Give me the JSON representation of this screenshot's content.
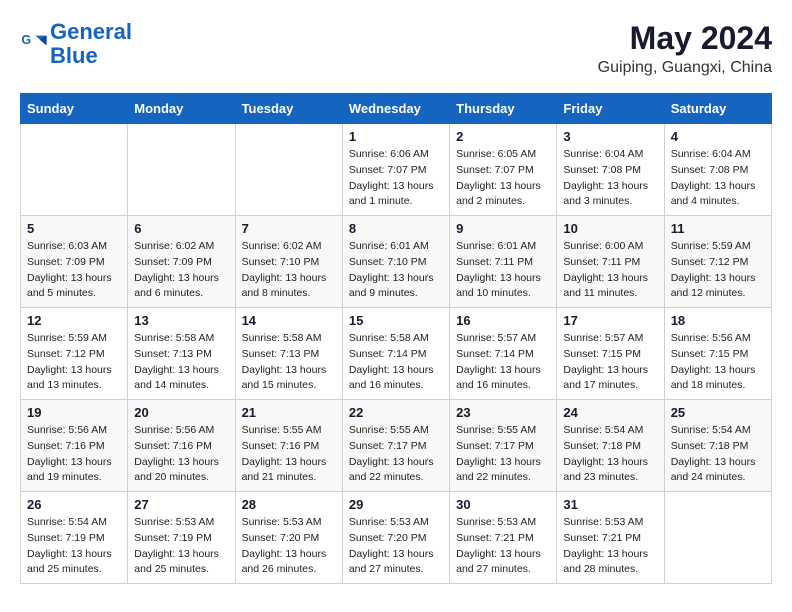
{
  "header": {
    "logo_general": "General",
    "logo_blue": "Blue",
    "month": "May 2024",
    "location": "Guiping, Guangxi, China"
  },
  "weekdays": [
    "Sunday",
    "Monday",
    "Tuesday",
    "Wednesday",
    "Thursday",
    "Friday",
    "Saturday"
  ],
  "weeks": [
    [
      {
        "day": "",
        "info": ""
      },
      {
        "day": "",
        "info": ""
      },
      {
        "day": "",
        "info": ""
      },
      {
        "day": "1",
        "info": "Sunrise: 6:06 AM\nSunset: 7:07 PM\nDaylight: 13 hours\nand 1 minute."
      },
      {
        "day": "2",
        "info": "Sunrise: 6:05 AM\nSunset: 7:07 PM\nDaylight: 13 hours\nand 2 minutes."
      },
      {
        "day": "3",
        "info": "Sunrise: 6:04 AM\nSunset: 7:08 PM\nDaylight: 13 hours\nand 3 minutes."
      },
      {
        "day": "4",
        "info": "Sunrise: 6:04 AM\nSunset: 7:08 PM\nDaylight: 13 hours\nand 4 minutes."
      }
    ],
    [
      {
        "day": "5",
        "info": "Sunrise: 6:03 AM\nSunset: 7:09 PM\nDaylight: 13 hours\nand 5 minutes."
      },
      {
        "day": "6",
        "info": "Sunrise: 6:02 AM\nSunset: 7:09 PM\nDaylight: 13 hours\nand 6 minutes."
      },
      {
        "day": "7",
        "info": "Sunrise: 6:02 AM\nSunset: 7:10 PM\nDaylight: 13 hours\nand 8 minutes."
      },
      {
        "day": "8",
        "info": "Sunrise: 6:01 AM\nSunset: 7:10 PM\nDaylight: 13 hours\nand 9 minutes."
      },
      {
        "day": "9",
        "info": "Sunrise: 6:01 AM\nSunset: 7:11 PM\nDaylight: 13 hours\nand 10 minutes."
      },
      {
        "day": "10",
        "info": "Sunrise: 6:00 AM\nSunset: 7:11 PM\nDaylight: 13 hours\nand 11 minutes."
      },
      {
        "day": "11",
        "info": "Sunrise: 5:59 AM\nSunset: 7:12 PM\nDaylight: 13 hours\nand 12 minutes."
      }
    ],
    [
      {
        "day": "12",
        "info": "Sunrise: 5:59 AM\nSunset: 7:12 PM\nDaylight: 13 hours\nand 13 minutes."
      },
      {
        "day": "13",
        "info": "Sunrise: 5:58 AM\nSunset: 7:13 PM\nDaylight: 13 hours\nand 14 minutes."
      },
      {
        "day": "14",
        "info": "Sunrise: 5:58 AM\nSunset: 7:13 PM\nDaylight: 13 hours\nand 15 minutes."
      },
      {
        "day": "15",
        "info": "Sunrise: 5:58 AM\nSunset: 7:14 PM\nDaylight: 13 hours\nand 16 minutes."
      },
      {
        "day": "16",
        "info": "Sunrise: 5:57 AM\nSunset: 7:14 PM\nDaylight: 13 hours\nand 16 minutes."
      },
      {
        "day": "17",
        "info": "Sunrise: 5:57 AM\nSunset: 7:15 PM\nDaylight: 13 hours\nand 17 minutes."
      },
      {
        "day": "18",
        "info": "Sunrise: 5:56 AM\nSunset: 7:15 PM\nDaylight: 13 hours\nand 18 minutes."
      }
    ],
    [
      {
        "day": "19",
        "info": "Sunrise: 5:56 AM\nSunset: 7:16 PM\nDaylight: 13 hours\nand 19 minutes."
      },
      {
        "day": "20",
        "info": "Sunrise: 5:56 AM\nSunset: 7:16 PM\nDaylight: 13 hours\nand 20 minutes."
      },
      {
        "day": "21",
        "info": "Sunrise: 5:55 AM\nSunset: 7:16 PM\nDaylight: 13 hours\nand 21 minutes."
      },
      {
        "day": "22",
        "info": "Sunrise: 5:55 AM\nSunset: 7:17 PM\nDaylight: 13 hours\nand 22 minutes."
      },
      {
        "day": "23",
        "info": "Sunrise: 5:55 AM\nSunset: 7:17 PM\nDaylight: 13 hours\nand 22 minutes."
      },
      {
        "day": "24",
        "info": "Sunrise: 5:54 AM\nSunset: 7:18 PM\nDaylight: 13 hours\nand 23 minutes."
      },
      {
        "day": "25",
        "info": "Sunrise: 5:54 AM\nSunset: 7:18 PM\nDaylight: 13 hours\nand 24 minutes."
      }
    ],
    [
      {
        "day": "26",
        "info": "Sunrise: 5:54 AM\nSunset: 7:19 PM\nDaylight: 13 hours\nand 25 minutes."
      },
      {
        "day": "27",
        "info": "Sunrise: 5:53 AM\nSunset: 7:19 PM\nDaylight: 13 hours\nand 25 minutes."
      },
      {
        "day": "28",
        "info": "Sunrise: 5:53 AM\nSunset: 7:20 PM\nDaylight: 13 hours\nand 26 minutes."
      },
      {
        "day": "29",
        "info": "Sunrise: 5:53 AM\nSunset: 7:20 PM\nDaylight: 13 hours\nand 27 minutes."
      },
      {
        "day": "30",
        "info": "Sunrise: 5:53 AM\nSunset: 7:21 PM\nDaylight: 13 hours\nand 27 minutes."
      },
      {
        "day": "31",
        "info": "Sunrise: 5:53 AM\nSunset: 7:21 PM\nDaylight: 13 hours\nand 28 minutes."
      },
      {
        "day": "",
        "info": ""
      }
    ]
  ]
}
